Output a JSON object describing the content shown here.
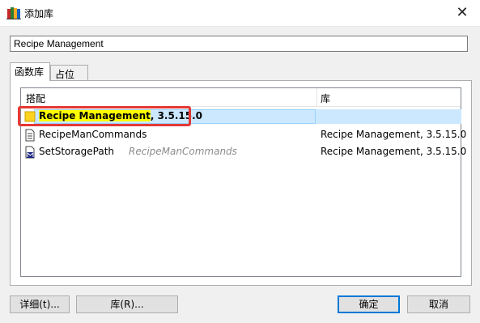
{
  "window": {
    "title": "添加库",
    "close_glyph": "✕"
  },
  "search": {
    "value": "Recipe Management"
  },
  "tabs": [
    {
      "label": "函数库",
      "active": true
    },
    {
      "label": "占位符",
      "active": false
    }
  ],
  "table": {
    "headers": {
      "match": "搭配",
      "library": "库"
    },
    "rows": [
      {
        "name_highlight": "Recipe Management",
        "name_rest": ", 3.5.15.0",
        "library": "",
        "icon": "folder-icon",
        "selected": true
      },
      {
        "name": "RecipeManCommands",
        "library": "Recipe Management, 3.5.15.0",
        "icon": "document-icon"
      },
      {
        "name": "SetStoragePath",
        "namespace": "RecipeManCommands",
        "library": "Recipe Management, 3.5.15.0",
        "icon": "method-icon"
      }
    ]
  },
  "buttons": {
    "details": "详细(t)...",
    "library": "库(R)...",
    "ok": "确定",
    "cancel": "取消"
  },
  "colors": {
    "selection": "#cce8ff",
    "highlight": "#ffff00",
    "annotation": "#e53935",
    "accent": "#0078d7"
  }
}
